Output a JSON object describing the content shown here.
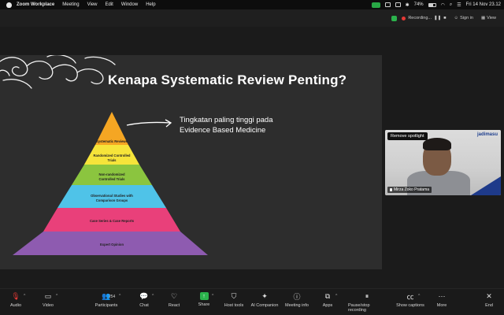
{
  "menubar": {
    "app_name": "Zoom Workplace",
    "items": [
      "Meeting",
      "View",
      "Edit",
      "Window",
      "Help"
    ],
    "battery": "74%",
    "datetime": "Fri 14 Nov 23.12"
  },
  "topbar": {
    "recording": "Recording...",
    "signin": "Sign in",
    "view": "View"
  },
  "slide": {
    "title": "Kenapa Systematic Review Penting?",
    "note_line1": "Tingkatan paling tinggi pada",
    "note_line2": "Evidence Based Medicine",
    "levels": [
      {
        "label": "Systematic Reviews",
        "color": "#f5a623"
      },
      {
        "label": "Randomized Controlled Trials",
        "color": "#f6e43a"
      },
      {
        "label": "Non-randomized Controlled Trials",
        "color": "#8bc53f"
      },
      {
        "label": "Observational Studies with Comparison Groups",
        "color": "#4fc3e8"
      },
      {
        "label": "Case Series & Case Reports",
        "color": "#e9407a"
      },
      {
        "label": "Expert Opinion",
        "color": "#8e5bb0"
      }
    ]
  },
  "camera": {
    "remove_spotlight": "Remove spotlight",
    "name": "Mirza Zoko Pratama",
    "logo": "jadimasu"
  },
  "dock": {
    "audio": "Audio",
    "video": "Video",
    "participants": "Participants",
    "participant_count": "254",
    "chat": "Chat",
    "react": "React",
    "share": "Share",
    "host_tools": "Host tools",
    "ai_companion": "AI Companion",
    "meeting_info": "Meeting info",
    "apps": "Apps",
    "pause_recording": "Pause/stop recording",
    "captions": "Show captions",
    "more": "More",
    "end": "End"
  }
}
